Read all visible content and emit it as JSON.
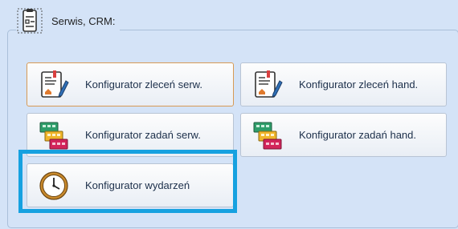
{
  "group": {
    "title": "Serwis, CRM:",
    "icon": "service-document-icon"
  },
  "buttons": {
    "zlecen_serw": {
      "label": "Konfigurator zleceń serw.",
      "icon": "order-document-pen-icon"
    },
    "zlecen_hand": {
      "label": "Konfigurator zleceń hand.",
      "icon": "order-document-pen-icon"
    },
    "zadan_serw": {
      "label": "Konfigurator zadań serw.",
      "icon": "task-stack-icon"
    },
    "zadan_hand": {
      "label": "Konfigurator zadań hand.",
      "icon": "task-stack-icon"
    },
    "wydarzen": {
      "label": "Konfigurator wydarzeń",
      "icon": "clock-icon"
    }
  },
  "colors": {
    "highlight": "#16a1e0",
    "active_border": "#d79a55",
    "background": "#d4e3f7"
  }
}
